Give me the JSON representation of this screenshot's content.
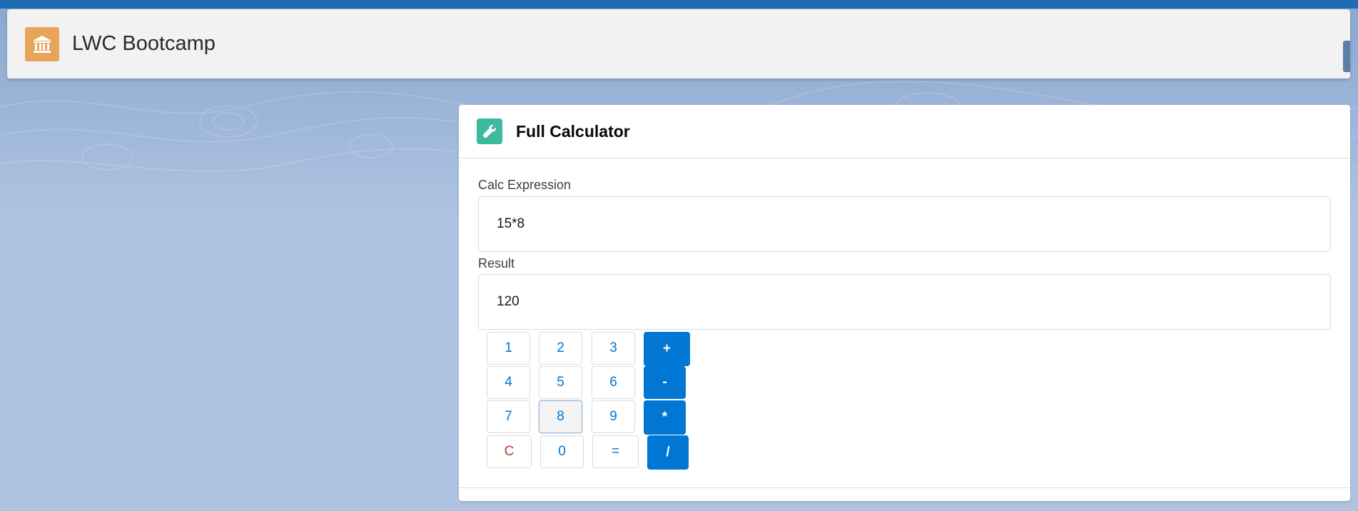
{
  "app": {
    "title": "LWC Bootcamp",
    "icon": "bank-icon",
    "icon_color": "#e8a55a"
  },
  "card": {
    "title": "Full Calculator",
    "icon": "wrench-icon",
    "icon_color": "#3db9a0"
  },
  "expression": {
    "label": "Calc Expression",
    "value": "15*8"
  },
  "result": {
    "label": "Result",
    "value": "120"
  },
  "keys": [
    {
      "label": "1"
    },
    {
      "label": "2"
    },
    {
      "label": "3"
    },
    {
      "label": "+"
    },
    {
      "label": "4"
    },
    {
      "label": "5"
    },
    {
      "label": "6"
    },
    {
      "label": "-"
    },
    {
      "label": "7"
    },
    {
      "label": "8"
    },
    {
      "label": "9"
    },
    {
      "label": "*"
    },
    {
      "label": "C"
    },
    {
      "label": "0"
    },
    {
      "label": "="
    },
    {
      "label": "/"
    }
  ],
  "colors": {
    "brand_blue": "#0176d3",
    "clear_red": "#c23934"
  }
}
